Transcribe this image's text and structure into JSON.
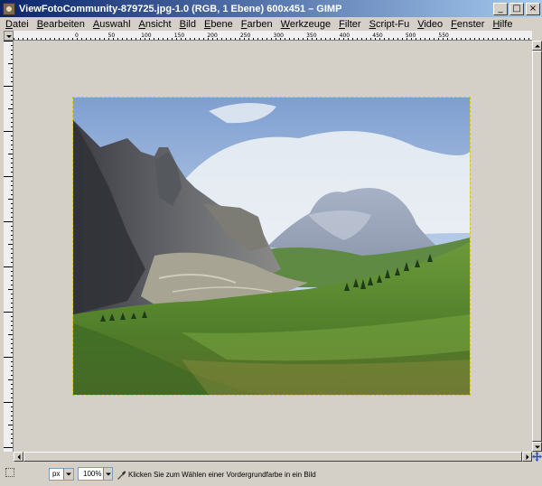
{
  "window": {
    "title": "ViewFotoCommunity-879725.jpg-1.0 (RGB, 1 Ebene) 600x451 – GIMP",
    "controls": {
      "minimize": "_",
      "maximize": "□",
      "close": "×"
    }
  },
  "menubar": {
    "items": [
      "Datei",
      "Bearbeiten",
      "Auswahl",
      "Ansicht",
      "Bild",
      "Ebene",
      "Farben",
      "Werkzeuge",
      "Filter",
      "Script-Fu",
      "Video",
      "Fenster",
      "Hilfe"
    ]
  },
  "rulers": {
    "horizontal_labels": [
      "0",
      "50",
      "100",
      "150",
      "200",
      "250",
      "300",
      "350",
      "400",
      "450",
      "500",
      "550"
    ]
  },
  "statusbar": {
    "unit": "px",
    "zoom": "100%",
    "message": "Klicken Sie zum Wählen einer Vordergrundfarbe in ein Bild"
  },
  "icons": {
    "app": "gimp-image-icon",
    "quickmask": "quick-mask-icon",
    "navigate": "navigate-icon",
    "picker": "color-picker-icon"
  },
  "colors": {
    "title_start": "#0a246a",
    "title_end": "#a6caf0",
    "canvas_bg": "#d4d0c8",
    "selection_outline": "#d7c500"
  }
}
